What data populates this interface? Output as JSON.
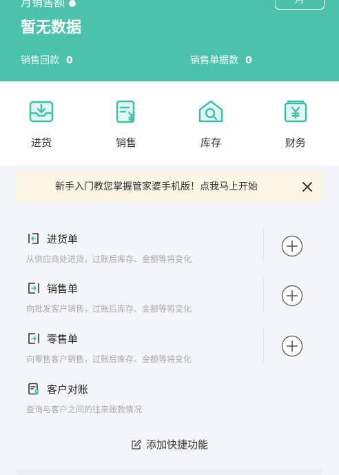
{
  "header": {
    "top_label": "月销售额",
    "month_button": "月",
    "title": "暂无数据",
    "stats": [
      {
        "label": "销售回款",
        "value": "0"
      },
      {
        "label": "销售单据数",
        "value": "0"
      }
    ],
    "bg_color": "#4cc1ac"
  },
  "quicknav": [
    {
      "label": "进货",
      "icon": "inbox-download-icon"
    },
    {
      "label": "销售",
      "icon": "sales-doc-yen-icon"
    },
    {
      "label": "库存",
      "icon": "warehouse-search-icon"
    },
    {
      "label": "财务",
      "icon": "finance-yen-icon"
    }
  ],
  "notice": {
    "text": "新手入门教您掌握管家婆手机版！点我马上开始",
    "close_icon": "close-icon"
  },
  "cards": [
    {
      "title": "进货单",
      "desc": "从供应商处进货，过账后库存、金额等将变化",
      "icon": "arrow-in-doc-icon",
      "has_add": true
    },
    {
      "title": "销售单",
      "desc": "向批发客户销售，过账后库存、金额等将变化",
      "icon": "arrow-out-doc-icon",
      "has_add": true
    },
    {
      "title": "零售单",
      "desc": "向零售客户销售，过账后库存、金额等将变化",
      "icon": "arrow-out-doc-icon",
      "has_add": true
    },
    {
      "title": "客户对账",
      "desc": "查询与客户之间的往来账款情况",
      "icon": "customer-statement-icon",
      "has_add": false
    }
  ],
  "add_shortcut": {
    "label": "添加快捷功能",
    "icon": "edit-icon"
  },
  "accent_color": "#3bbfa8"
}
